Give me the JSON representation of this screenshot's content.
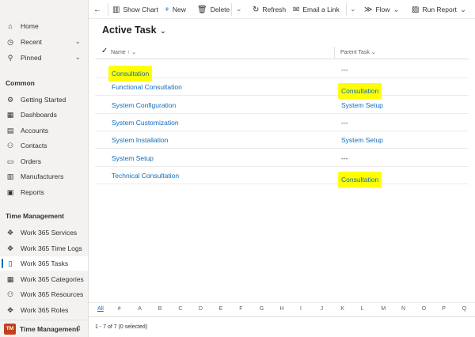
{
  "sidebar": {
    "nav": [
      {
        "label": "Home",
        "icon": "home-icon"
      },
      {
        "label": "Recent",
        "icon": "clock-icon"
      },
      {
        "label": "Pinned",
        "icon": "pin-icon"
      }
    ],
    "sections": [
      {
        "title": "Common",
        "items": [
          {
            "label": "Getting Started",
            "icon": "gear-icon"
          },
          {
            "label": "Dashboards",
            "icon": "dashboard-icon"
          },
          {
            "label": "Accounts",
            "icon": "accounts-icon"
          },
          {
            "label": "Contacts",
            "icon": "person-icon"
          },
          {
            "label": "Orders",
            "icon": "orders-icon"
          },
          {
            "label": "Manufacturers",
            "icon": "building-icon"
          },
          {
            "label": "Reports",
            "icon": "reports-icon"
          }
        ]
      },
      {
        "title": "Time Management",
        "items": [
          {
            "label": "Work 365 Services",
            "icon": "puzzle-icon"
          },
          {
            "label": "Work 365 Time Logs",
            "icon": "puzzle-icon"
          },
          {
            "label": "Work 365 Tasks",
            "icon": "task-icon"
          },
          {
            "label": "Work 365 Categories",
            "icon": "grid-icon"
          },
          {
            "label": "Work 365 Resources",
            "icon": "person-icon"
          },
          {
            "label": "Work 365 Roles",
            "icon": "puzzle-icon"
          }
        ]
      }
    ],
    "footer": {
      "avatar": "TM",
      "area": "Time Management"
    }
  },
  "commandbar": {
    "back": "←",
    "show_chart": "Show Chart",
    "new": "New",
    "delete": "Delete",
    "refresh": "Refresh",
    "email_link": "Email a Link",
    "flow": "Flow",
    "run_report": "Run Report"
  },
  "view": {
    "title": "Active Task"
  },
  "grid": {
    "columns": {
      "name": "Name ↑",
      "parent": "Parent Task"
    },
    "rows": [
      {
        "name": "Consultation",
        "parent": "---",
        "name_highlight": true,
        "parent_highlight": false,
        "parent_link": false
      },
      {
        "name": "Functional Consultation",
        "parent": "Consultation",
        "name_highlight": false,
        "parent_highlight": true,
        "parent_link": true
      },
      {
        "name": "System Configuration",
        "parent": "System Setup",
        "name_highlight": false,
        "parent_highlight": false,
        "parent_link": true
      },
      {
        "name": "System Customization",
        "parent": "---",
        "name_highlight": false,
        "parent_highlight": false,
        "parent_link": false
      },
      {
        "name": "System Installation",
        "parent": "System Setup",
        "name_highlight": false,
        "parent_highlight": false,
        "parent_link": true
      },
      {
        "name": "System Setup",
        "parent": "---",
        "name_highlight": false,
        "parent_highlight": false,
        "parent_link": false
      },
      {
        "name": "Technical Consultation",
        "parent": "Consultation",
        "name_highlight": false,
        "parent_highlight": true,
        "parent_link": true
      }
    ],
    "highlight_color": "#ffff00",
    "link_color": "#0f6cbd"
  },
  "jumpbar": [
    "All",
    "#",
    "A",
    "B",
    "C",
    "D",
    "E",
    "F",
    "G",
    "H",
    "I",
    "J",
    "K",
    "L",
    "M",
    "N",
    "O",
    "P",
    "Q"
  ],
  "status": "1 - 7 of 7 (0 selected)"
}
